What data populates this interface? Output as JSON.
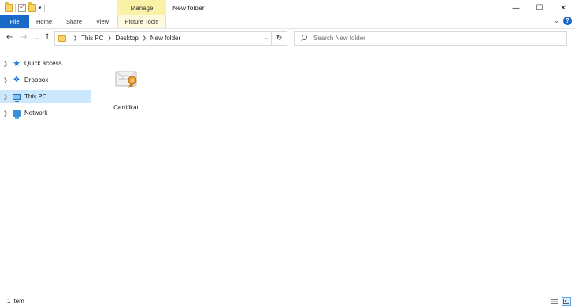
{
  "window": {
    "title": "New folder",
    "contextual_tab_group": "Manage",
    "controls": {
      "minimize": "—",
      "maximize": "☐",
      "close": "✕"
    }
  },
  "ribbon": {
    "tabs": [
      {
        "label": "File"
      },
      {
        "label": "Home"
      },
      {
        "label": "Share"
      },
      {
        "label": "View"
      },
      {
        "label": "Picture Tools"
      }
    ],
    "collapse_icon": "chevron-down-icon",
    "help_icon": "?"
  },
  "navigation": {
    "back_icon": "←",
    "forward_icon": "→",
    "recent_icon": "⌄",
    "up_icon": "↑",
    "breadcrumb": [
      "This PC",
      "Desktop",
      "New folder"
    ],
    "refresh_icon": "↻",
    "search_placeholder": "Search New folder"
  },
  "nav_pane": {
    "items": [
      {
        "label": "Quick access",
        "icon": "star-icon",
        "selected": false
      },
      {
        "label": "Dropbox",
        "icon": "dropbox-icon",
        "selected": false
      },
      {
        "label": "This PC",
        "icon": "computer-icon",
        "selected": true
      },
      {
        "label": "Network",
        "icon": "network-icon",
        "selected": false
      }
    ]
  },
  "files": [
    {
      "name": "Certifikat",
      "icon": "certificate-icon"
    }
  ],
  "status": {
    "item_count": "1 item"
  },
  "colors": {
    "file_tab": "#1a68c8",
    "manage_tab": "#f8f1a6",
    "selection": "#cce8ff"
  }
}
